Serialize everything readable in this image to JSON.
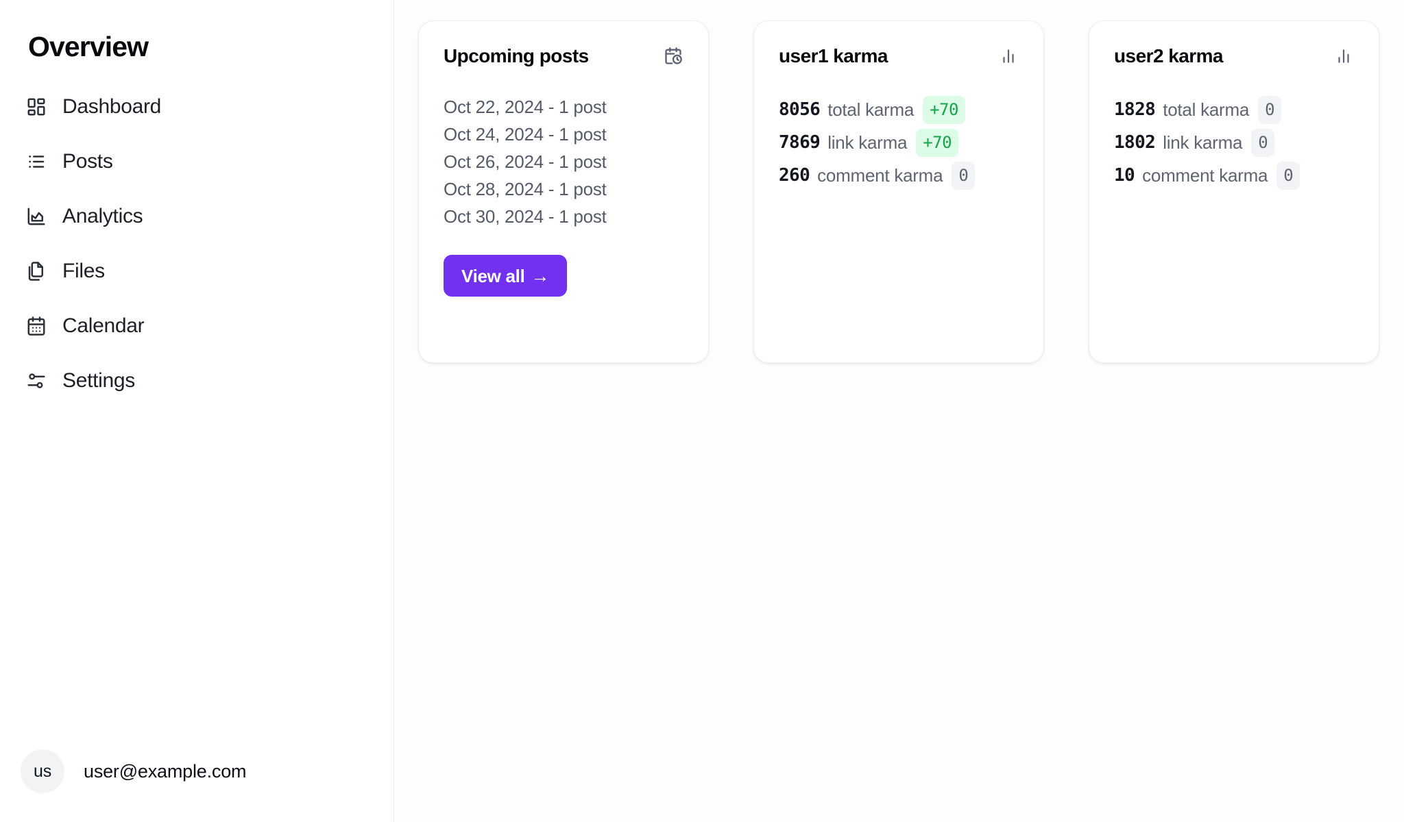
{
  "sidebar": {
    "title": "Overview",
    "items": [
      {
        "label": "Dashboard",
        "icon": "layout-dashboard-icon"
      },
      {
        "label": "Posts",
        "icon": "list-icon"
      },
      {
        "label": "Analytics",
        "icon": "chart-area-icon"
      },
      {
        "label": "Files",
        "icon": "files-copy-icon"
      },
      {
        "label": "Calendar",
        "icon": "calendar-days-icon"
      },
      {
        "label": "Settings",
        "icon": "sliders-settings-icon"
      }
    ],
    "footer": {
      "avatar_initials": "us",
      "email": "user@example.com"
    }
  },
  "main": {
    "cards": [
      {
        "id": "upcoming-posts",
        "title": "Upcoming posts",
        "icon": "calendar-clock-icon",
        "posts": [
          "Oct 22, 2024 - 1 post",
          "Oct 24, 2024 - 1 post",
          "Oct 26, 2024 - 1 post",
          "Oct 28, 2024 - 1 post",
          "Oct 30, 2024 - 1 post"
        ],
        "button_label": "View all",
        "button_arrow": "→"
      },
      {
        "id": "user1-karma",
        "title": "user1 karma",
        "icon": "bar-chart-icon",
        "rows": [
          {
            "value": "8056",
            "label": "total karma",
            "badge": "+70",
            "badge_kind": "pos"
          },
          {
            "value": "7869",
            "label": "link karma",
            "badge": "+70",
            "badge_kind": "pos"
          },
          {
            "value": "260",
            "label": "comment karma",
            "badge": "0",
            "badge_kind": "zero"
          }
        ]
      },
      {
        "id": "user2-karma",
        "title": "user2 karma",
        "icon": "bar-chart-icon",
        "rows": [
          {
            "value": "1828",
            "label": "total karma",
            "badge": "0",
            "badge_kind": "zero"
          },
          {
            "value": "1802",
            "label": "link karma",
            "badge": "0",
            "badge_kind": "zero"
          },
          {
            "value": "10",
            "label": "comment karma",
            "badge": "0",
            "badge_kind": "zero"
          }
        ]
      }
    ]
  },
  "colors": {
    "accent": "#7231ef",
    "badge_positive_bg": "#dcfce7",
    "badge_positive_text": "#16a34a",
    "badge_zero_bg": "#f1f3f6",
    "badge_zero_text": "#5e646f",
    "card_bg": "#ffffff",
    "main_bg": "#fdfdfe"
  }
}
